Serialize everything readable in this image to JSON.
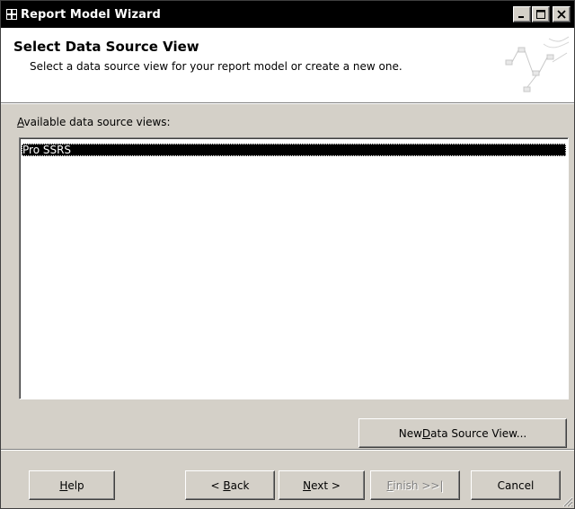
{
  "window": {
    "title": "Report Model Wizard",
    "icon": "wizard-app-icon",
    "caption_buttons": [
      "minimize-icon",
      "maximize-icon",
      "close-icon"
    ]
  },
  "header": {
    "title": "Select Data Source View",
    "subtitle": "Select a data source view for your report model or create a new one.",
    "graphic": "wizard-banner-graphic"
  },
  "list": {
    "label_prefix": "",
    "label_accel": "A",
    "label_rest": "vailable data source views:",
    "items": [
      "Pro SSRS"
    ],
    "selected_index": 0
  },
  "buttons": {
    "new_dsv": {
      "prefix": "New ",
      "accel": "D",
      "rest": "ata Source View..."
    },
    "help": {
      "prefix": "",
      "accel": "H",
      "rest": "elp"
    },
    "back": {
      "prefix": "< ",
      "accel": "B",
      "rest": "ack"
    },
    "next": {
      "prefix": "",
      "accel": "N",
      "rest": "ext >"
    },
    "finish": {
      "prefix": "",
      "accel": "F",
      "rest": "inish >>|",
      "enabled": false
    },
    "cancel": {
      "prefix": "",
      "accel": "",
      "rest": "Cancel"
    }
  },
  "colors": {
    "face": "#d4d0c8",
    "titlebar": "#000000",
    "selection": "#000000",
    "header_bg": "#ffffff"
  }
}
